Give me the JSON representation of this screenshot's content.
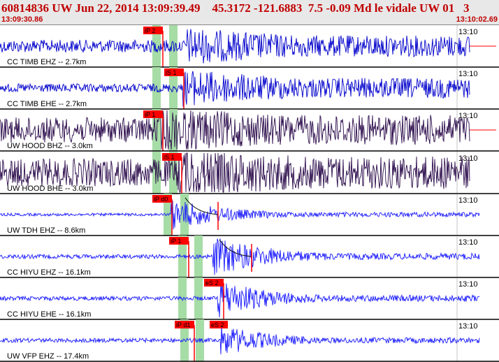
{
  "header": {
    "title": "60814836 UW Jun 22, 2014 13:09:39.49    45.3172 -121.6883  7.5 -0.09 Md le vidale UW 01   3",
    "start_time": "13:09:30.86",
    "end_time": "13:10:02.69"
  },
  "colors": {
    "header_text": "#c00000",
    "trace_blue": "#0000dd",
    "trace_dark": "#2a0a4a",
    "pick_red": "#ff0000",
    "highlight_green": "#a6dca6",
    "separator": "#000000"
  },
  "minute_label": "13:10",
  "traces": [
    {
      "label": "CC TIMB EHZ -- 2.7km",
      "color": "dark_blue",
      "pick": "iP 2"
    },
    {
      "label": "CC TIMB EHE -- 2.7km",
      "color": "dark_blue",
      "pick": "iS 1"
    },
    {
      "label": "UW HOOD BHZ -- 3.0km",
      "color": "dark_purple",
      "pick": "iP 1"
    },
    {
      "label": "UW HOOD BHE -- 3.0km",
      "color": "dark_purple",
      "pick": "iS 1"
    },
    {
      "label": "UW TDH EHZ -- 8.6km",
      "color": "blue",
      "pick": "iP d0"
    },
    {
      "label": "CC HIYU EHZ -- 16.1km",
      "color": "blue",
      "pick": "iP 1"
    },
    {
      "label": "CC HIYU EHE -- 16.1km",
      "color": "blue",
      "pick": "eS 2"
    },
    {
      "label": "UW VFP EHZ -- 17.4km",
      "color": "blue",
      "pick": "iP d1",
      "pick2": "eS 2"
    }
  ]
}
